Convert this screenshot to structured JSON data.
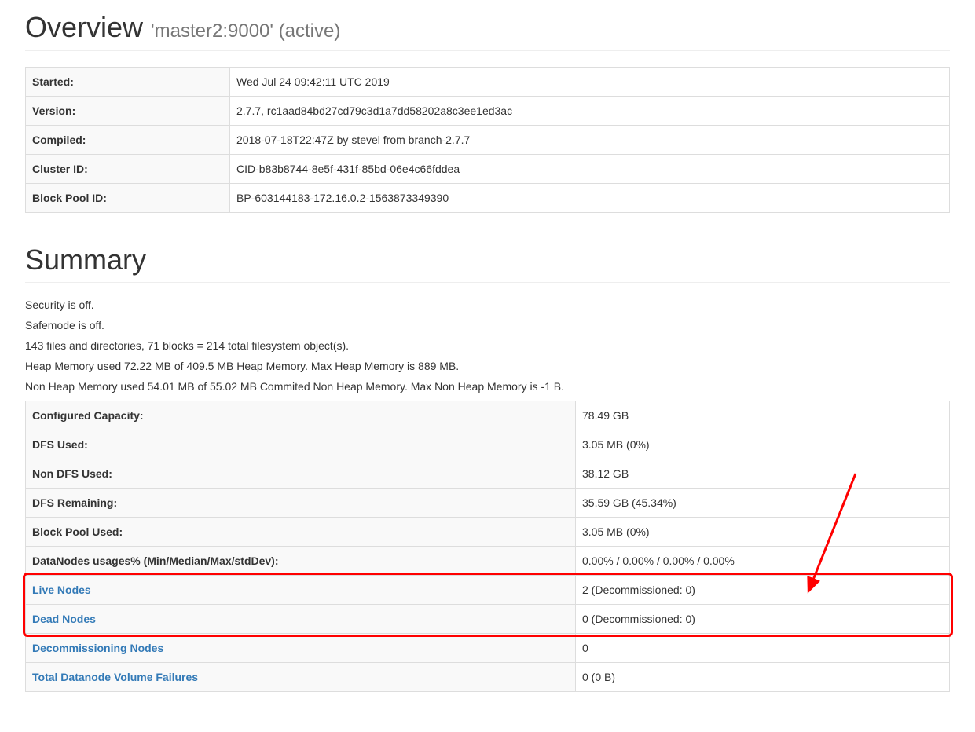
{
  "overview": {
    "title": "Overview",
    "subtitle": "'master2:9000' (active)",
    "rows": [
      {
        "label": "Started:",
        "value": "Wed Jul 24 09:42:11 UTC 2019"
      },
      {
        "label": "Version:",
        "value": "2.7.7, rc1aad84bd27cd79c3d1a7dd58202a8c3ee1ed3ac"
      },
      {
        "label": "Compiled:",
        "value": "2018-07-18T22:47Z by stevel from branch-2.7.7"
      },
      {
        "label": "Cluster ID:",
        "value": "CID-b83b8744-8e5f-431f-85bd-06e4c66fddea"
      },
      {
        "label": "Block Pool ID:",
        "value": "BP-603144183-172.16.0.2-1563873349390"
      }
    ]
  },
  "summary": {
    "title": "Summary",
    "text": [
      "Security is off.",
      "Safemode is off.",
      "143 files and directories, 71 blocks = 214 total filesystem object(s).",
      "Heap Memory used 72.22 MB of 409.5 MB Heap Memory. Max Heap Memory is 889 MB.",
      "Non Heap Memory used 54.01 MB of 55.02 MB Commited Non Heap Memory. Max Non Heap Memory is -1 B."
    ],
    "rows": [
      {
        "label": "Configured Capacity:",
        "value": "78.49 GB",
        "link": false
      },
      {
        "label": "DFS Used:",
        "value": "3.05 MB (0%)",
        "link": false
      },
      {
        "label": "Non DFS Used:",
        "value": "38.12 GB",
        "link": false
      },
      {
        "label": "DFS Remaining:",
        "value": "35.59 GB (45.34%)",
        "link": false
      },
      {
        "label": "Block Pool Used:",
        "value": "3.05 MB (0%)",
        "link": false
      },
      {
        "label": "DataNodes usages% (Min/Median/Max/stdDev):",
        "value": "0.00% / 0.00% / 0.00% / 0.00%",
        "link": false
      },
      {
        "label": "Live Nodes",
        "value": "2 (Decommissioned: 0)",
        "link": true
      },
      {
        "label": "Dead Nodes",
        "value": "0 (Decommissioned: 0)",
        "link": true
      },
      {
        "label": "Decommissioning Nodes",
        "value": "0",
        "link": true
      },
      {
        "label": "Total Datanode Volume Failures",
        "value": "0 (0 B)",
        "link": true
      }
    ]
  }
}
